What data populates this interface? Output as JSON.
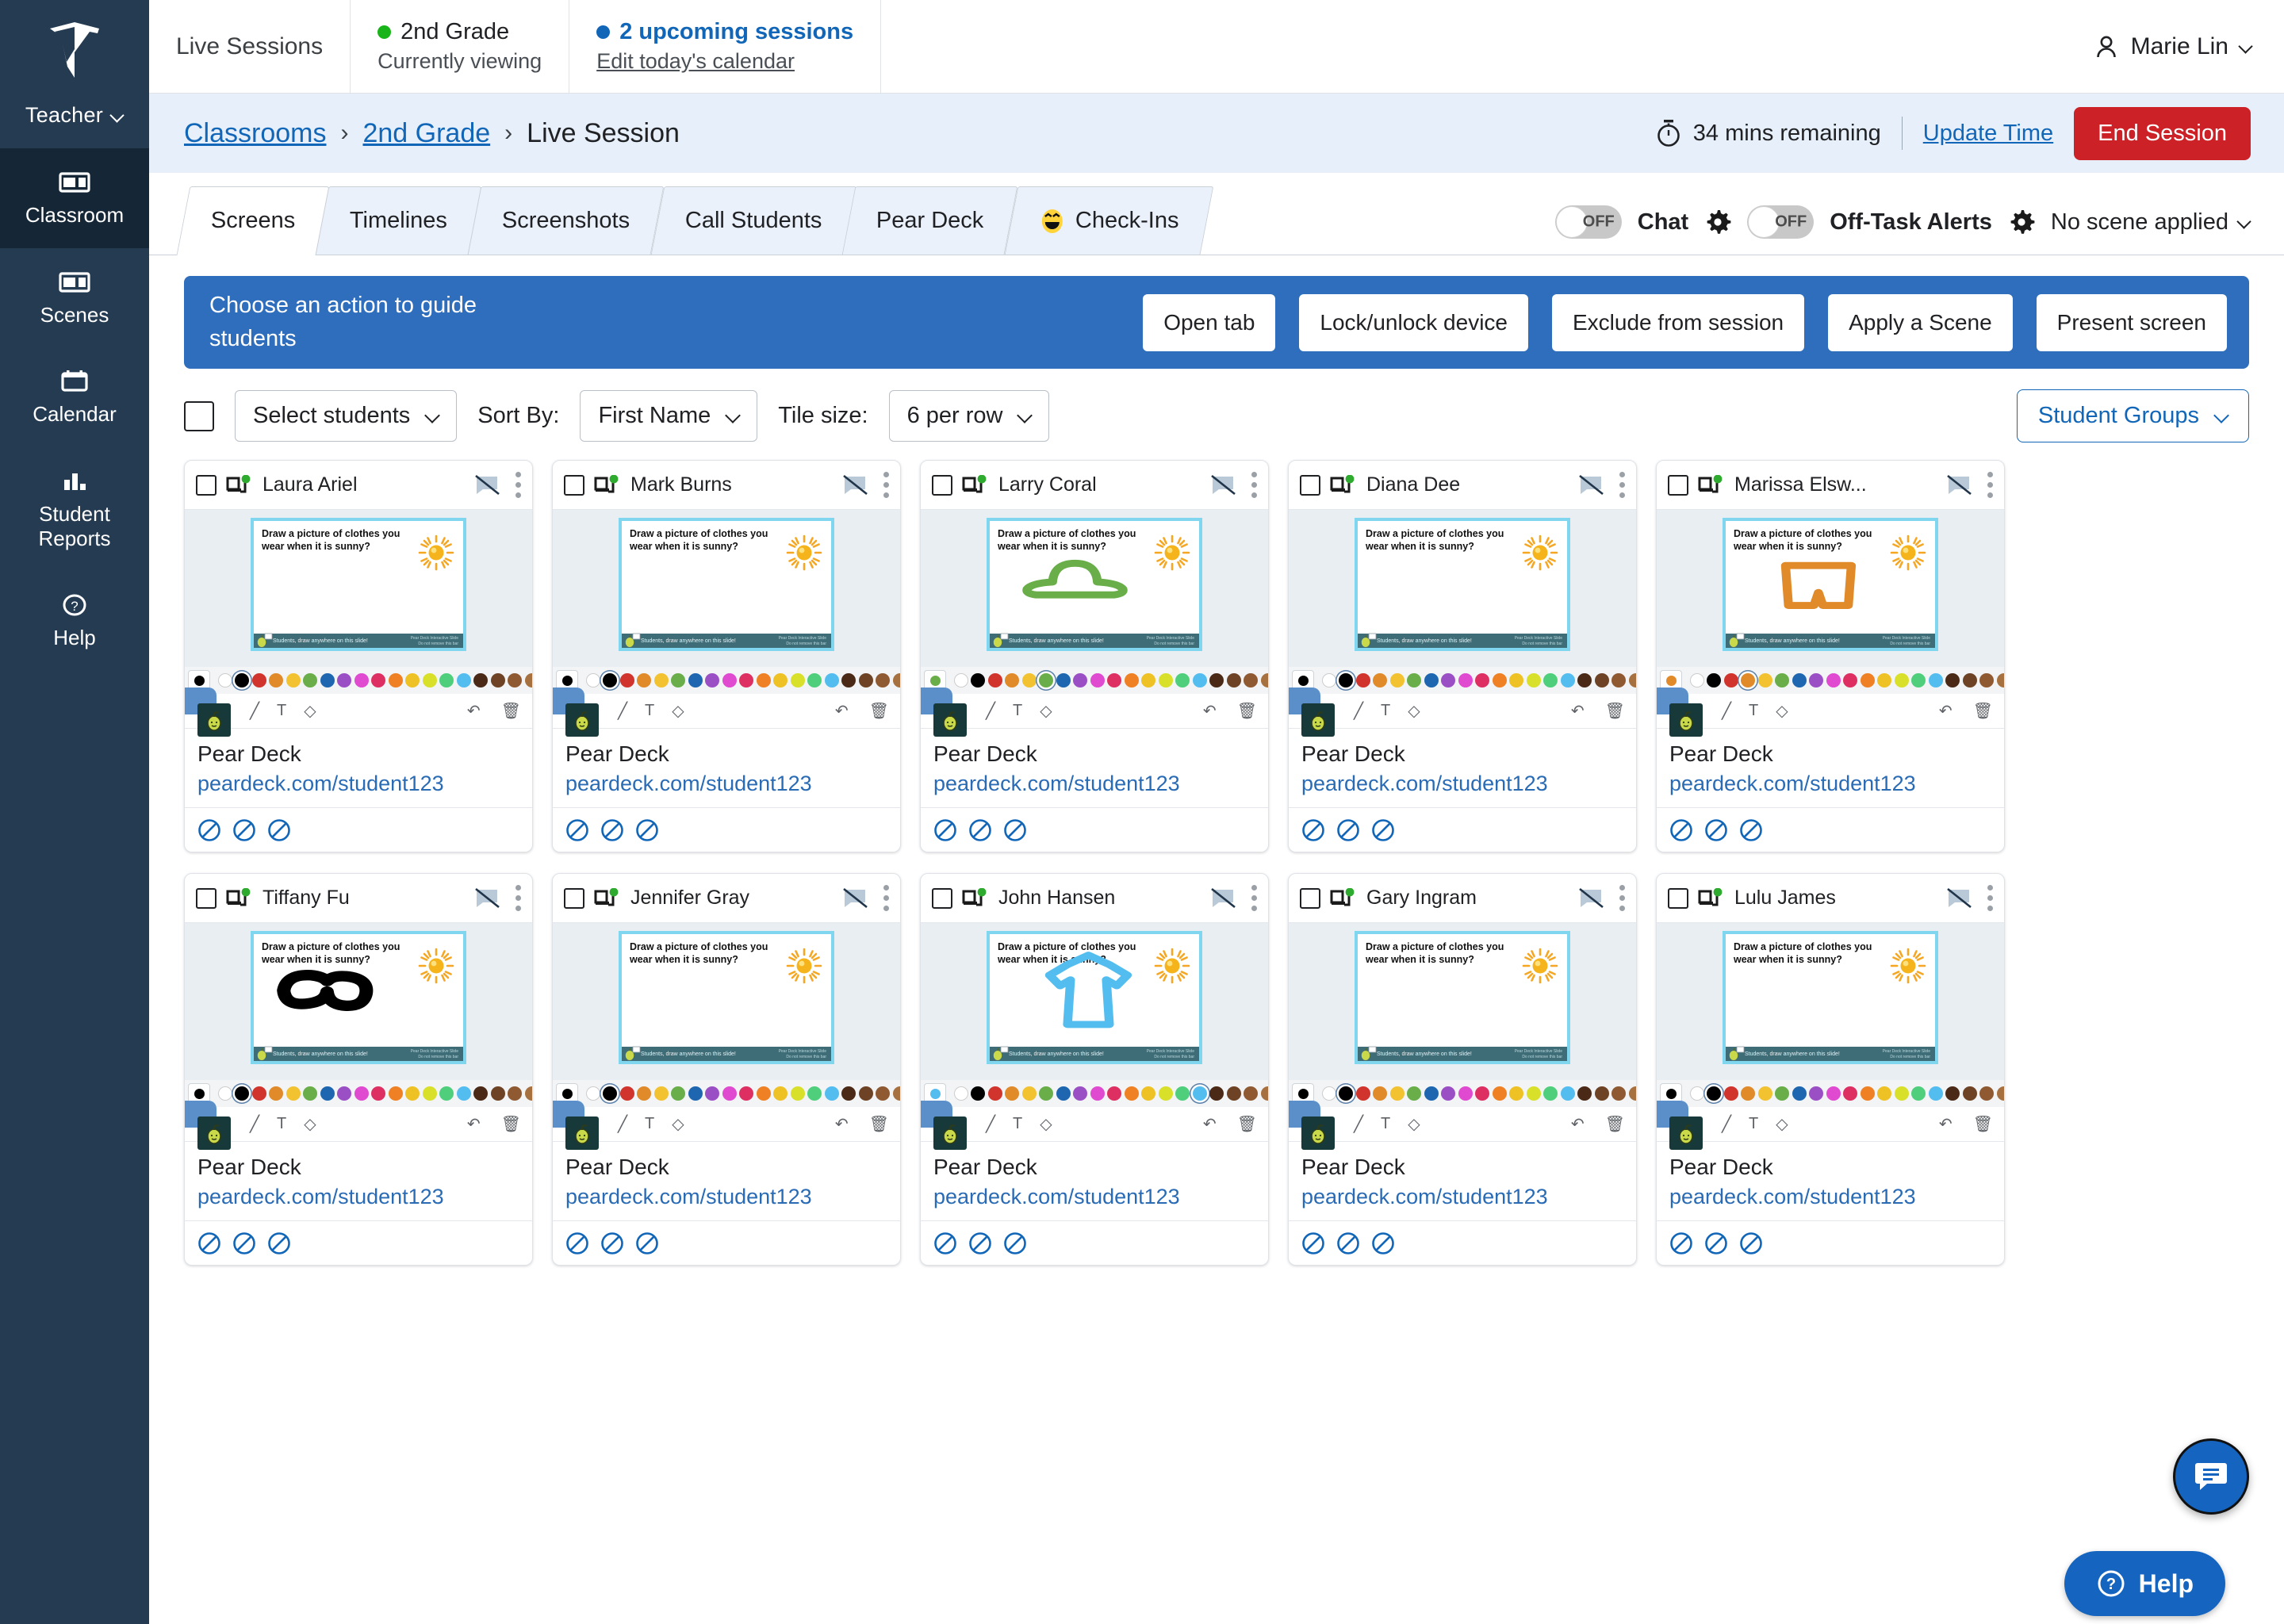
{
  "sidebar": {
    "logo_icon": "shield-logo-icon",
    "role_label": "Teacher",
    "items": [
      {
        "label": "Classroom",
        "icon": "classroom-icon",
        "active": true
      },
      {
        "label": "Scenes",
        "icon": "scenes-icon",
        "active": false
      },
      {
        "label": "Calendar",
        "icon": "calendar-icon",
        "active": false
      },
      {
        "label": "Student Reports",
        "icon": "bar-chart-icon",
        "active": false
      },
      {
        "label": "Help",
        "icon": "question-circle-icon",
        "active": false
      }
    ]
  },
  "topbar": {
    "live_sessions_label": "Live Sessions",
    "current_class": {
      "name": "2nd Grade",
      "status": "Currently viewing",
      "dot_color": "#19b419"
    },
    "upcoming": {
      "name": "2 upcoming sessions",
      "action": "Edit today's calendar",
      "dot_color": "#1266b8"
    },
    "user": {
      "name": "Marie Lin",
      "icon": "person-icon",
      "chevron": "chevron-down-icon"
    }
  },
  "breadcrumb": {
    "items": [
      {
        "label": "Classrooms",
        "link": true
      },
      {
        "label": "2nd Grade",
        "link": true
      },
      {
        "label": "Live Session",
        "link": false
      }
    ],
    "separator": "›",
    "timer_icon": "stopwatch-icon",
    "timer_text": "34 mins remaining",
    "update_time_label": "Update Time",
    "end_session_label": "End Session",
    "end_session_color": "#cc2127"
  },
  "tabs": [
    {
      "label": "Screens",
      "active": true,
      "icon": null
    },
    {
      "label": "Timelines",
      "active": false,
      "icon": null
    },
    {
      "label": "Screenshots",
      "active": false,
      "icon": null
    },
    {
      "label": "Call Students",
      "active": false,
      "icon": null
    },
    {
      "label": "Pear Deck",
      "active": false,
      "icon": null
    },
    {
      "label": "Check-Ins",
      "active": false,
      "icon": "grinning-face-emoji"
    }
  ],
  "tab_controls": {
    "chat": {
      "state": "OFF",
      "label": "Chat",
      "gear_icon": "gear-icon"
    },
    "off_task": {
      "state": "OFF",
      "label": "Off-Task Alerts",
      "gear_icon": "gear-icon"
    },
    "scene": {
      "label": "No scene applied",
      "chevron": "chevron-down-icon"
    }
  },
  "action_bar": {
    "prompt": "Choose an action to guide students",
    "background": "#2f6ebc",
    "buttons": [
      "Open tab",
      "Lock/unlock device",
      "Exclude from session",
      "Apply a Scene",
      "Present screen"
    ]
  },
  "filters": {
    "select_all_checkbox": false,
    "select_students": "Select students",
    "sort_by_label": "Sort By:",
    "sort_by_value": "First Name",
    "tile_size_label": "Tile size:",
    "tile_size_value": "6 per row",
    "student_groups_label": "Student Groups"
  },
  "slide": {
    "question": "Draw a picture of clothes you wear when it is sunny?",
    "footer_text": "Students, draw anywhere on this slide!",
    "footer_right_1": "Pear Deck Interactive Slide",
    "footer_right_2": "Do not remove this bar",
    "border_color": "#7fd6ee",
    "footer_color": "#3e6d78",
    "sun_icon": "sun-icon"
  },
  "palette_colors": [
    "#ffffff",
    "#000000",
    "#d0342c",
    "#e08a2a",
    "#f2c230",
    "#6aae4a",
    "#1f66b0",
    "#9b4fc4",
    "#e04ad0",
    "#de2f63",
    "#ef8023",
    "#eec224",
    "#d8e02a",
    "#4fce7c",
    "#54bdf0",
    "#4a2a17",
    "#6d4225",
    "#8f5a32",
    "#a6703f",
    "#c18e5c",
    "#d2a273",
    "#c9ad8e",
    "#e2bb93",
    "#eccfae",
    "#f2ddc4"
  ],
  "card_common": {
    "app_name": "Pear Deck",
    "app_url": "peardeck.com/student123",
    "app_icon": "pear-deck-icon",
    "device_icon": "device-online-icon",
    "online_dot_color": "#2eaa2e",
    "chat_off_icon": "chat-disabled-icon",
    "kebab_icon": "more-vertical-icon",
    "restricted_icons": [
      "block-icon",
      "block-icon",
      "block-icon"
    ],
    "toolbar_icons": [
      "pen-icon",
      "text-icon",
      "eraser-icon",
      "undo-icon",
      "trash-icon"
    ]
  },
  "students": [
    {
      "name": "Laura Ariel",
      "online": true,
      "drawing": "none",
      "pen_color": "#000000",
      "selected_swatch": 1
    },
    {
      "name": "Mark Burns",
      "online": true,
      "drawing": "none",
      "pen_color": "#000000",
      "selected_swatch": 1
    },
    {
      "name": "Larry Coral",
      "online": true,
      "drawing": "hat",
      "pen_color": "#6aae4a",
      "selected_swatch": 5
    },
    {
      "name": "Diana Dee",
      "online": true,
      "drawing": "none",
      "pen_color": "#000000",
      "selected_swatch": 1
    },
    {
      "name": "Marissa Elsw...",
      "online": true,
      "drawing": "shorts",
      "pen_color": "#e08a2a",
      "selected_swatch": 3
    },
    {
      "name": "Tiffany Fu",
      "online": true,
      "drawing": "sunglasses",
      "pen_color": "#000000",
      "selected_swatch": 1
    },
    {
      "name": "Jennifer Gray",
      "online": true,
      "drawing": "none",
      "pen_color": "#000000",
      "selected_swatch": 1
    },
    {
      "name": "John Hansen",
      "online": true,
      "drawing": "tshirt",
      "pen_color": "#54bdf0",
      "selected_swatch": 14
    },
    {
      "name": "Gary Ingram",
      "online": true,
      "drawing": "none",
      "pen_color": "#000000",
      "selected_swatch": 1
    },
    {
      "name": "Lulu James",
      "online": true,
      "drawing": "none",
      "pen_color": "#000000",
      "selected_swatch": 1
    }
  ],
  "floating": {
    "chat_fab_icon": "chat-bubble-icon",
    "help_label": "Help",
    "help_icon": "question-circle-icon",
    "accent": "#1565c0"
  }
}
